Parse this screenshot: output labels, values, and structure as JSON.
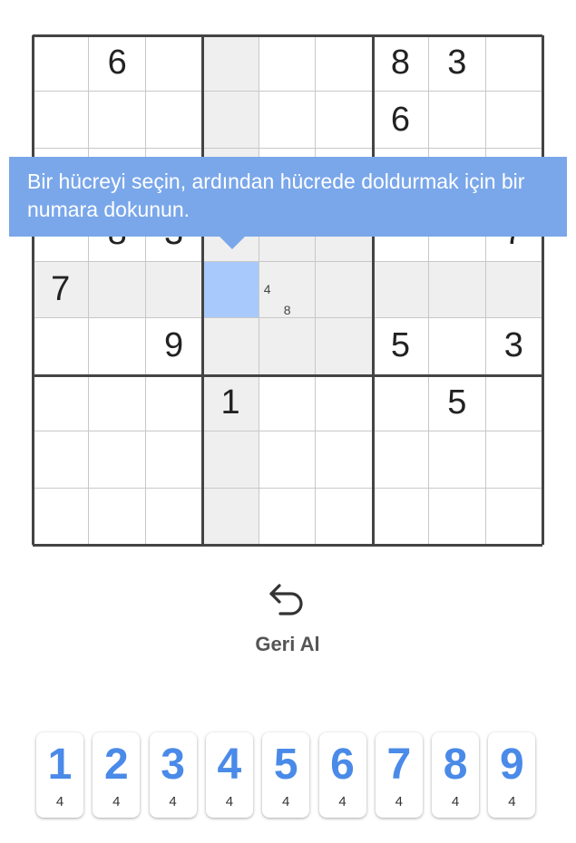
{
  "grid": [
    [
      "",
      "6",
      "",
      "",
      "",
      "",
      "8",
      "3",
      ""
    ],
    [
      "",
      "",
      "",
      "",
      "",
      "",
      "6",
      "",
      ""
    ],
    [
      "",
      "",
      "",
      "",
      "",
      "",
      "",
      "",
      ""
    ],
    [
      "",
      "8",
      "3",
      "",
      "",
      "",
      "",
      "",
      "7"
    ],
    [
      "7",
      "",
      "",
      "",
      "",
      "",
      "",
      "",
      ""
    ],
    [
      "",
      "",
      "9",
      "",
      "",
      "",
      "5",
      "",
      "3"
    ],
    [
      "",
      "",
      "",
      "1",
      "",
      "",
      "",
      "5",
      ""
    ],
    [
      "",
      "",
      "",
      "",
      "",
      "",
      "",
      "",
      ""
    ],
    [
      "",
      "",
      "",
      "",
      "",
      "",
      "",
      "",
      ""
    ]
  ],
  "highlighted_cells": [
    [
      0,
      3
    ],
    [
      1,
      3
    ],
    [
      2,
      3
    ],
    [
      3,
      3
    ],
    [
      4,
      3
    ],
    [
      5,
      3
    ],
    [
      6,
      3
    ],
    [
      7,
      3
    ],
    [
      8,
      3
    ],
    [
      3,
      4
    ],
    [
      3,
      5
    ],
    [
      4,
      0
    ],
    [
      4,
      1
    ],
    [
      4,
      2
    ],
    [
      4,
      4
    ],
    [
      4,
      5
    ],
    [
      4,
      6
    ],
    [
      4,
      7
    ],
    [
      4,
      8
    ],
    [
      5,
      4
    ],
    [
      5,
      5
    ]
  ],
  "selected_cell": [
    4,
    3
  ],
  "pencil_notes": [
    {
      "row": 4,
      "col": 4,
      "numbers": [
        "4",
        "8"
      ]
    }
  ],
  "tooltip": {
    "text": "Bir hücreyi seçin, ardından hücrede doldurmak için bir numara dokunun."
  },
  "undo": {
    "label": "Geri Al",
    "icon": "undo-arrow-icon"
  },
  "numpad": [
    {
      "digit": "1",
      "remaining": "4"
    },
    {
      "digit": "2",
      "remaining": "4"
    },
    {
      "digit": "3",
      "remaining": "4"
    },
    {
      "digit": "4",
      "remaining": "4"
    },
    {
      "digit": "5",
      "remaining": "4"
    },
    {
      "digit": "6",
      "remaining": "4"
    },
    {
      "digit": "7",
      "remaining": "4"
    },
    {
      "digit": "8",
      "remaining": "4"
    },
    {
      "digit": "9",
      "remaining": "4"
    }
  ],
  "colors": {
    "accent": "#4a8ae8",
    "selected": "#a8c9fb",
    "highlight": "#efefef",
    "tooltip": "#7aa7ea"
  }
}
